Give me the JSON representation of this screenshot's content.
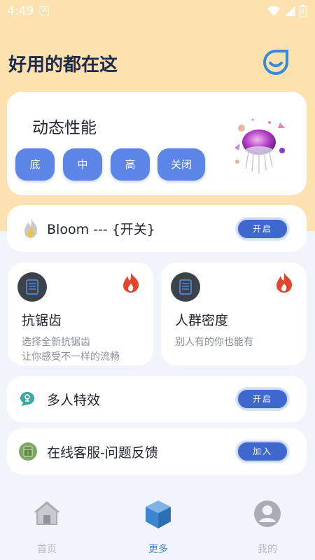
{
  "status_bar": {
    "time": "4:49",
    "a_icon": "A"
  },
  "header": {
    "title": "好用的都在这"
  },
  "performance": {
    "title": "动态性能",
    "buttons": [
      "底",
      "中",
      "高",
      "关闭"
    ]
  },
  "bloom": {
    "label": "Bloom --- {开关}",
    "button": "开启"
  },
  "features": [
    {
      "title": "抗锯齿",
      "sub1": "选择全新抗锯齿",
      "sub2": "让你感受不一样的流畅"
    },
    {
      "title": "人群密度",
      "sub1": "别人有的你也能有",
      "sub2": ""
    }
  ],
  "multi": {
    "label": "多人特效",
    "button": "开启"
  },
  "service": {
    "label": "在线客服-问题反馈",
    "button": "加入"
  },
  "nav": {
    "items": [
      {
        "label": "首页",
        "icon": "home-icon",
        "active": false
      },
      {
        "label": "更多",
        "icon": "cube-icon",
        "active": true
      },
      {
        "label": "我的",
        "icon": "user-icon",
        "active": false
      }
    ]
  },
  "colors": {
    "accent": "#5b86e8",
    "pill": "#3f68cf",
    "top_bg": "#fde1ae",
    "lower_bg": "#f2f4fb",
    "fire": "#e2452b"
  }
}
